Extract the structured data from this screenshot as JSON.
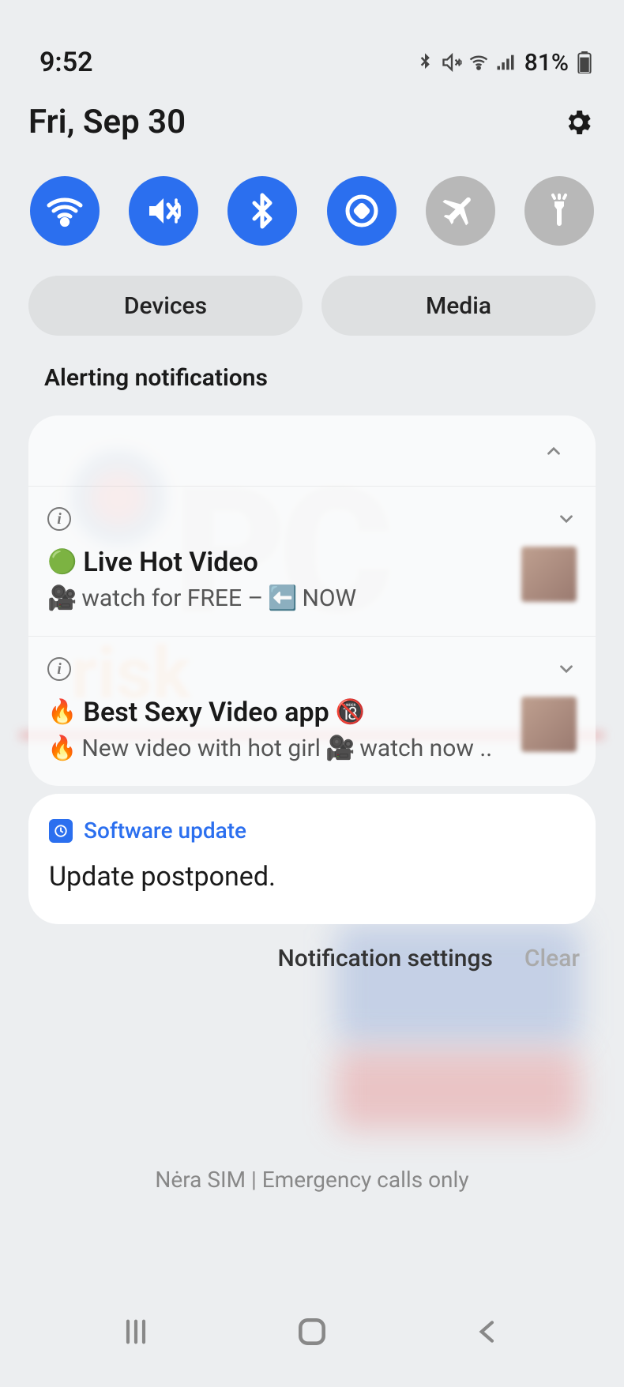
{
  "status": {
    "time": "9:52",
    "battery": "81%"
  },
  "header": {
    "date": "Fri, Sep 30"
  },
  "pills": {
    "devices": "Devices",
    "media": "Media"
  },
  "section": {
    "alerting": "Alerting notifications"
  },
  "notifications": [
    {
      "title": "Live Hot Video",
      "subtitle_prefix": "watch for FREE –",
      "subtitle_suffix": "NOW"
    },
    {
      "title": "Best Sexy Video app",
      "subtitle_prefix": "New video with hot girl",
      "subtitle_suffix": "watch now .."
    }
  ],
  "update": {
    "app": "Software update",
    "body": "Update postponed."
  },
  "footer": {
    "settings": "Notification settings",
    "clear": "Clear"
  },
  "sim": "Nėra SIM | Emergency calls only"
}
